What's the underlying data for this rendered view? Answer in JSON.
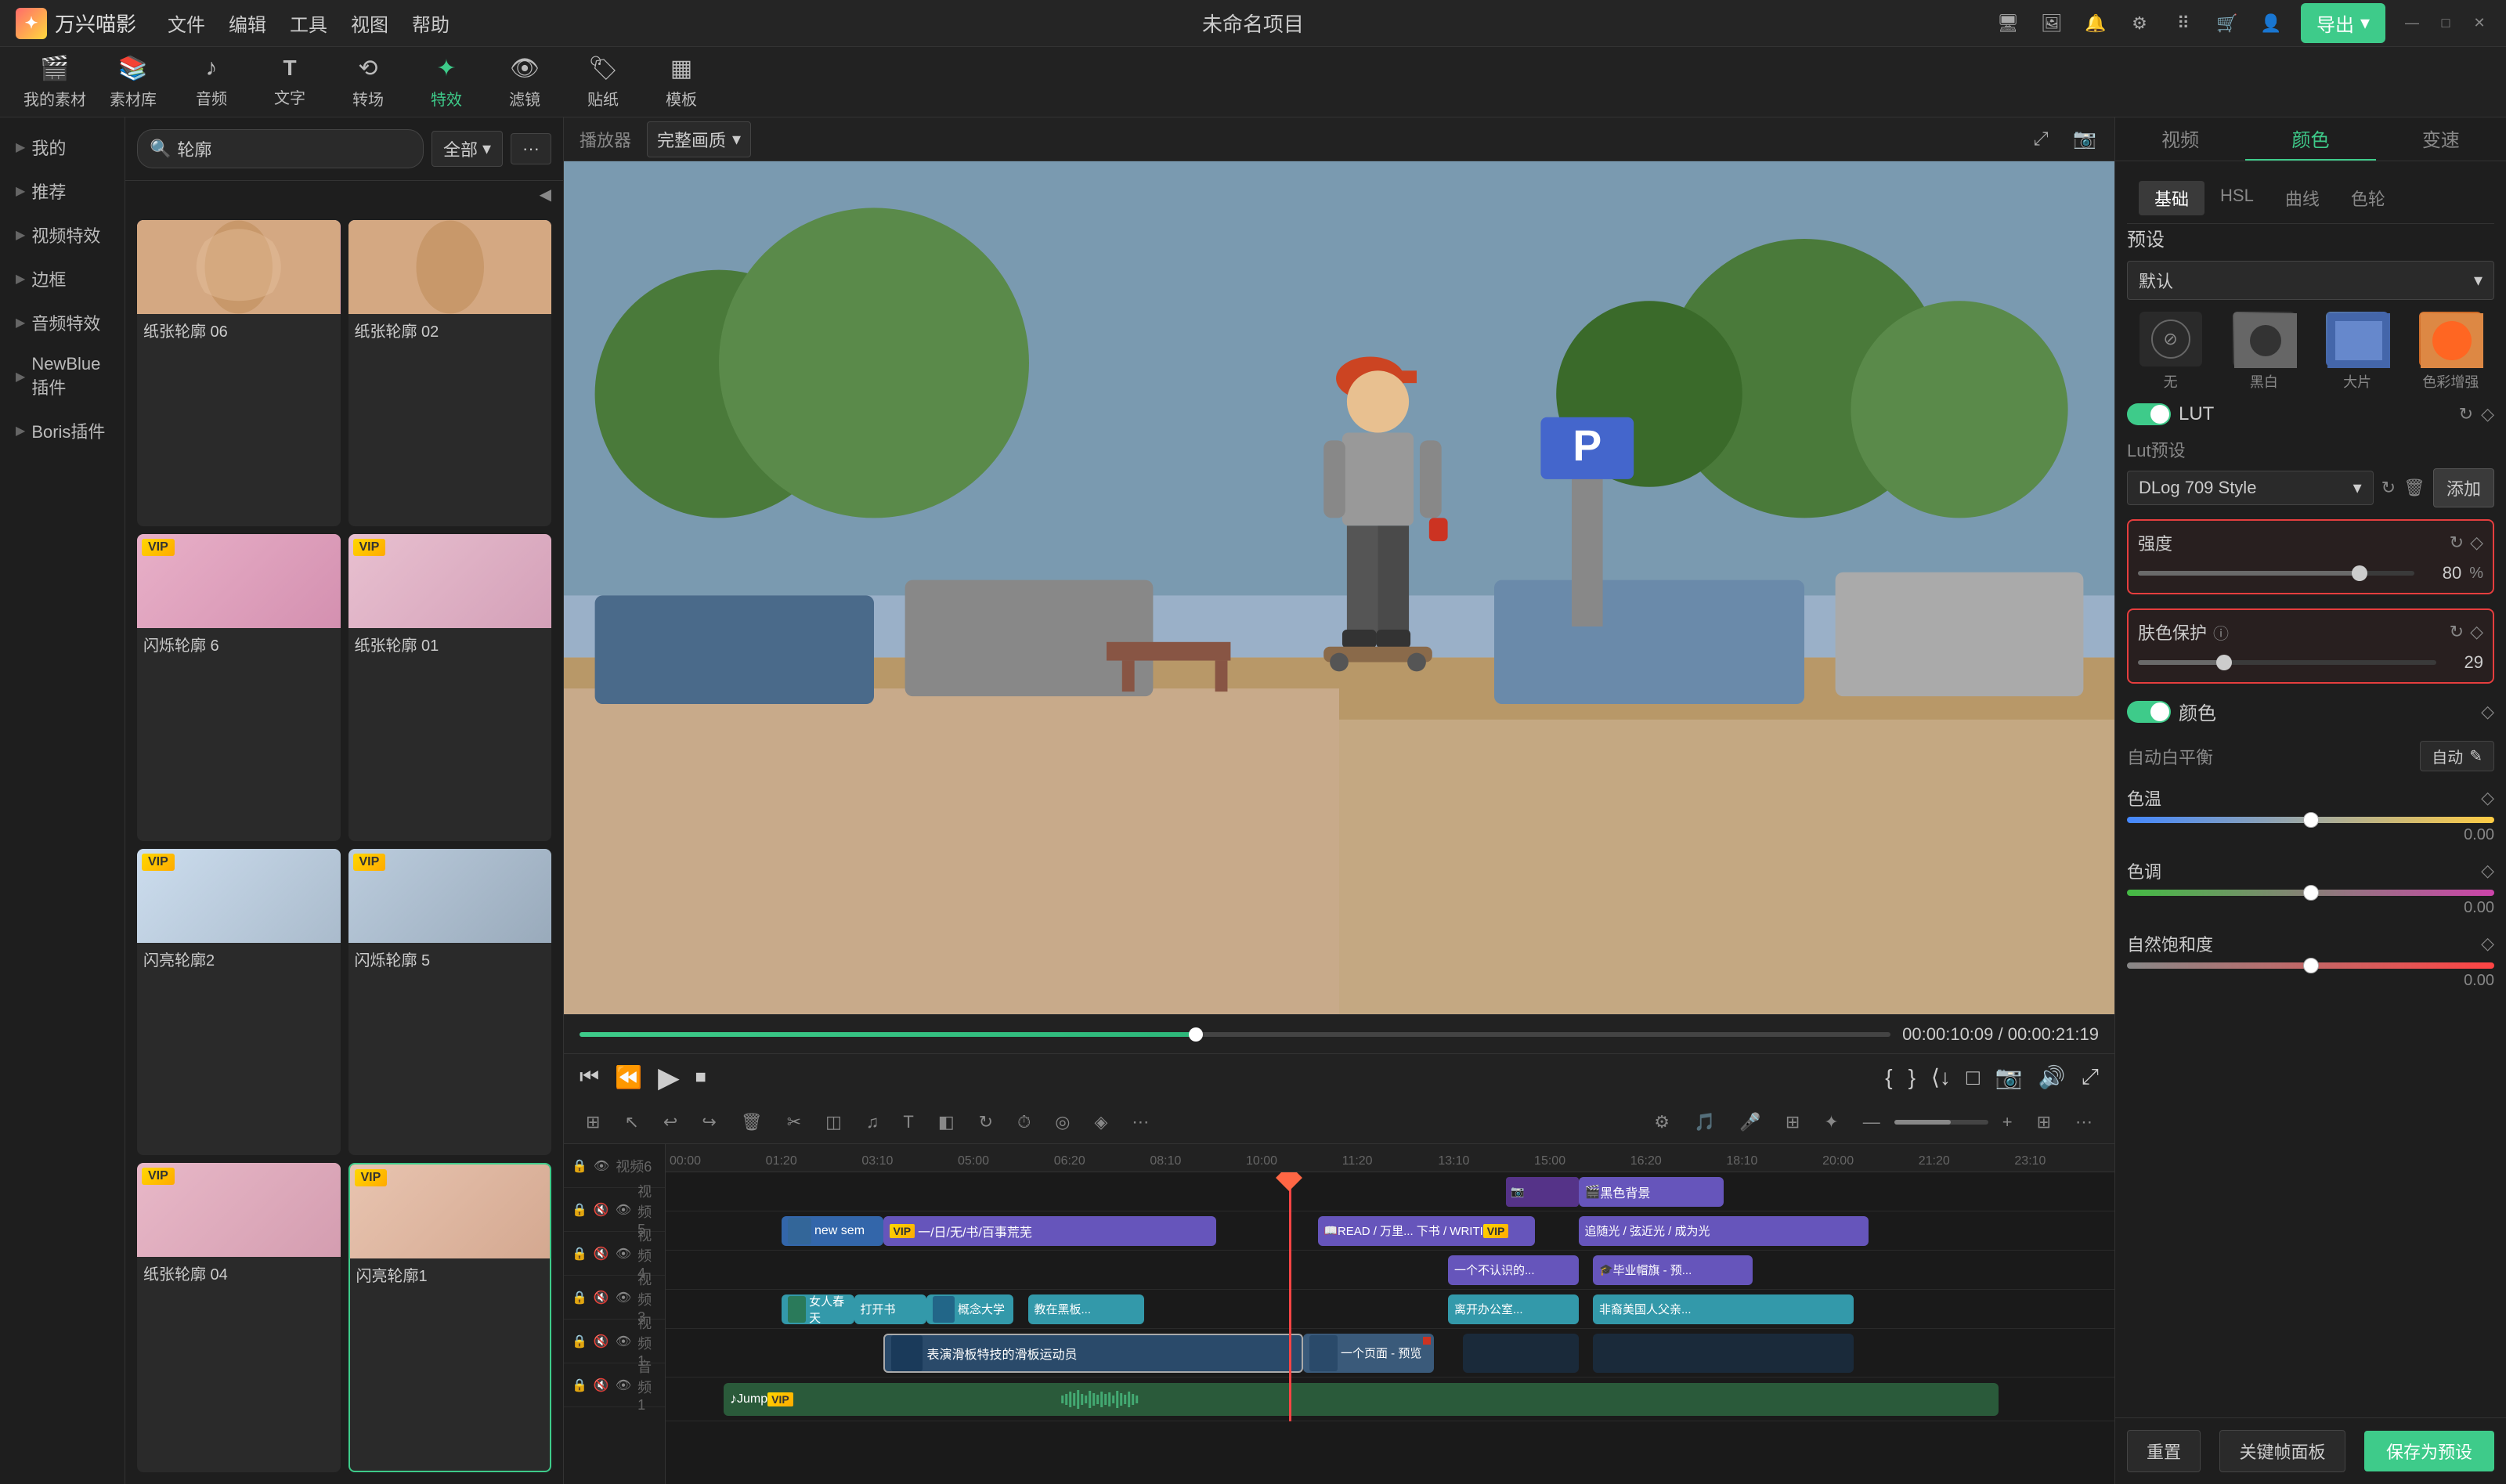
{
  "app": {
    "name": "万兴喵影",
    "title": "未命名项目",
    "logo_char": "✦"
  },
  "title_bar": {
    "menus": [
      "文件",
      "编辑",
      "工具",
      "视图",
      "帮助"
    ],
    "export_label": "导出",
    "win_btns": [
      "—",
      "□",
      "✕"
    ]
  },
  "toolbar": {
    "items": [
      {
        "icon": "🎬",
        "label": "我的素材"
      },
      {
        "icon": "📚",
        "label": "素材库"
      },
      {
        "icon": "♪",
        "label": "音频"
      },
      {
        "icon": "T",
        "label": "文字"
      },
      {
        "icon": "⟲",
        "label": "转场"
      },
      {
        "icon": "✦",
        "label": "特效"
      },
      {
        "icon": "👁",
        "label": "滤镜"
      },
      {
        "icon": "🏷",
        "label": "贴纸"
      },
      {
        "icon": "▦",
        "label": "模板"
      }
    ],
    "active": 5
  },
  "sidebar": {
    "items": [
      {
        "label": "我的",
        "has_arrow": true
      },
      {
        "label": "推荐",
        "has_arrow": true
      },
      {
        "label": "视频特效",
        "has_arrow": true
      },
      {
        "label": "边框",
        "has_arrow": true
      },
      {
        "label": "音频特效",
        "has_arrow": true
      },
      {
        "label": "NewBlue插件",
        "has_arrow": true
      },
      {
        "label": "Boris插件",
        "has_arrow": true
      }
    ]
  },
  "effects_panel": {
    "search_placeholder": "轮廓",
    "filter_label": "全部",
    "more_icon": "···",
    "items": [
      {
        "name": "纸张轮廓 06",
        "vip": false,
        "style": "girl"
      },
      {
        "name": "纸张轮廓 02",
        "vip": false,
        "style": "girl"
      },
      {
        "name": "闪烁轮廓 6",
        "vip": true,
        "style": "girl"
      },
      {
        "name": "纸张轮廓 01",
        "vip": true,
        "style": "girl"
      },
      {
        "name": "闪亮轮廓2",
        "vip": true,
        "style": "girl"
      },
      {
        "name": "闪烁轮廓 5",
        "vip": true,
        "style": "girl"
      },
      {
        "name": "纸张轮廓 04",
        "vip": true,
        "style": "girl"
      },
      {
        "name": "闪亮轮廓1",
        "vip": true,
        "style": "girl",
        "selected": true
      }
    ]
  },
  "preview": {
    "player_label": "播放器",
    "quality_label": "完整画质",
    "time_current": "00:00:10:09",
    "time_total": "00:00:21:19",
    "progress_pct": 47
  },
  "right_panel": {
    "tabs": [
      "视频",
      "颜色",
      "变速"
    ],
    "active_tab": "颜色",
    "color_subtabs": [
      "基础",
      "HSL",
      "曲线",
      "色轮"
    ],
    "active_subtab": "基础",
    "preset_section": {
      "label": "预设",
      "dropdown_value": "默认",
      "presets": [
        {
          "name": "无",
          "style": "none"
        },
        {
          "name": "黑白",
          "style": "bw"
        },
        {
          "name": "大片",
          "style": "film"
        },
        {
          "name": "色彩增强",
          "style": "vivid"
        }
      ]
    },
    "lut": {
      "toggle_label": "LUT",
      "enabled": true,
      "preset_label": "Lut预设",
      "preset_value": "DLog 709 Style",
      "add_label": "添加"
    },
    "intensity": {
      "label": "强度",
      "value": 80,
      "unit": "%",
      "highlighted": true
    },
    "skin_protect": {
      "label": "肤色保护",
      "info": true,
      "value": 29,
      "highlighted": true
    },
    "color_section": {
      "toggle_label": "颜色",
      "enabled": true
    },
    "auto_wb": {
      "label": "自动白平衡",
      "value": "自动",
      "icon": "✎"
    },
    "sliders": [
      {
        "name": "色温",
        "value": "0.00",
        "pos": 50
      },
      {
        "name": "色调",
        "value": "0.00",
        "pos": 50
      },
      {
        "name": "自然饱和度",
        "value": "0.00",
        "pos": 50
      }
    ],
    "buttons": {
      "reset": "重置",
      "keyframe": "关键帧面板",
      "save_preset": "保存为预设"
    }
  },
  "timeline": {
    "ruler_marks": [
      "00:00",
      "00:00:01:20",
      "00:00:03:10",
      "00:00:05:00",
      "00:00:06:20",
      "00:00:08:10",
      "00:00:10:00",
      "00:00:11:20",
      "00:00:13:10",
      "00:00:15:00",
      "00:00:16:20",
      "00:00:18:10",
      "00:00:20:00",
      "00:00:21:20",
      "00:00:23:10"
    ],
    "tracks": [
      {
        "id": "视频6",
        "type": "video"
      },
      {
        "id": "视频5",
        "type": "video"
      },
      {
        "id": "视频4",
        "type": "video"
      },
      {
        "id": "视频3",
        "type": "video"
      },
      {
        "id": "视频2",
        "type": "video"
      },
      {
        "id": "视频1",
        "type": "video"
      },
      {
        "id": "音频1",
        "type": "audio"
      }
    ],
    "playhead_pos_pct": 43,
    "clips": {
      "track6": [
        {
          "label": "黑色背景",
          "start_pct": 63,
          "width_pct": 10,
          "style": "purple"
        }
      ],
      "track5": [
        {
          "label": "new sem",
          "start_pct": 10,
          "width_pct": 8,
          "style": "blue"
        },
        {
          "label": "一/日/无/书/百事荒芜",
          "start_pct": 17,
          "width_pct": 22,
          "style": "purple",
          "vip": true
        },
        {
          "label": "READ / 万里... 下书 / WRITI",
          "start_pct": 46,
          "width_pct": 18,
          "style": "purple",
          "vip": false
        },
        {
          "label": "追随光 / 弦近光 / 成为光",
          "start_pct": 65,
          "width_pct": 20,
          "style": "purple"
        }
      ],
      "track4": [
        {
          "label": "一个不认识的...",
          "start_pct": 55,
          "width_pct": 10,
          "style": "purple"
        },
        {
          "label": "毕业帽旗 - 预...",
          "start_pct": 66,
          "width_pct": 11,
          "style": "purple"
        }
      ],
      "track3": [
        {
          "label": "女人春天",
          "start_pct": 10,
          "width_pct": 6,
          "style": "teal"
        },
        {
          "label": "打开书",
          "start_pct": 16,
          "width_pct": 5,
          "style": "teal"
        },
        {
          "label": "概念大学",
          "start_pct": 21,
          "width_pct": 6,
          "style": "teal"
        },
        {
          "label": "教在黑板...",
          "start_pct": 29,
          "width_pct": 8,
          "style": "teal"
        },
        {
          "label": "离开办公室...",
          "start_pct": 55,
          "width_pct": 10,
          "style": "teal"
        },
        {
          "label": "非裔美国人父亲...",
          "start_pct": 66,
          "width_pct": 18,
          "style": "teal"
        }
      ],
      "track2": [
        {
          "label": "表演滑板特技的滑板运动员",
          "start_pct": 17,
          "width_pct": 33,
          "style": "video-dark",
          "selected": true
        },
        {
          "label": "一个页面 - 预览",
          "start_pct": 44,
          "width_pct": 12,
          "style": "video"
        },
        {
          "label": "",
          "start_pct": 57,
          "width_pct": 8,
          "style": "video-dark"
        },
        {
          "label": "",
          "start_pct": 66,
          "width_pct": 20,
          "style": "video-dark"
        }
      ],
      "audio1": [
        {
          "label": "♪ Jump VIP",
          "start_pct": 5,
          "width_pct": 90,
          "style": "audio"
        }
      ]
    }
  }
}
